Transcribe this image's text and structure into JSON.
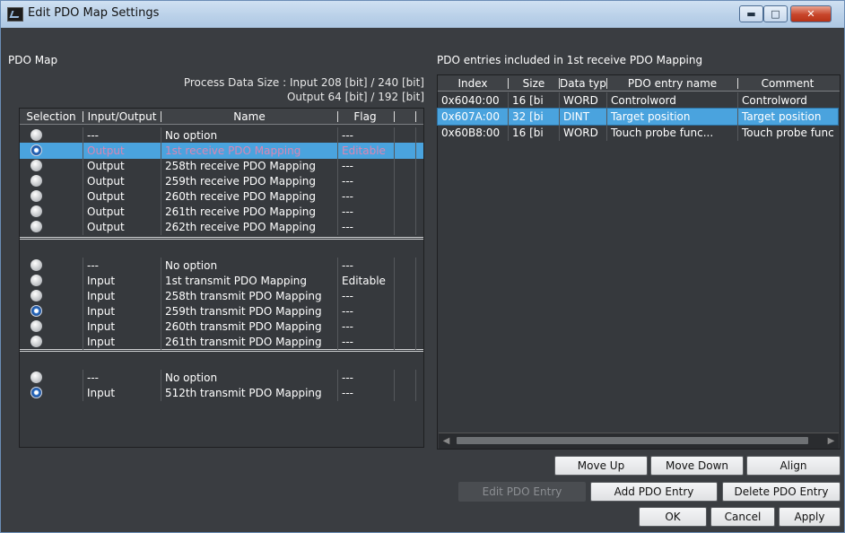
{
  "window": {
    "title": "Edit PDO Map Settings",
    "controls": {
      "minimize": "▬",
      "maximize": "□",
      "close": "✕"
    }
  },
  "pdo_map": {
    "label": "PDO Map",
    "process_size_input": "Process Data Size : Input  208 [bit]  /  240 [bit]",
    "process_size_output": "Output  64 [bit]  /  192 [bit]",
    "columns": [
      "Selection",
      "Input/Output",
      "Name",
      "Flag"
    ],
    "group1": [
      {
        "io": "---",
        "name": "No option",
        "flag": "---",
        "selected": false
      },
      {
        "io": "Output",
        "name": "1st receive PDO Mapping",
        "flag": "Editable",
        "selected": true
      },
      {
        "io": "Output",
        "name": "258th receive PDO Mapping",
        "flag": "---",
        "selected": false
      },
      {
        "io": "Output",
        "name": "259th receive PDO Mapping",
        "flag": "---",
        "selected": false
      },
      {
        "io": "Output",
        "name": "260th receive PDO Mapping",
        "flag": "---",
        "selected": false
      },
      {
        "io": "Output",
        "name": "261th receive PDO Mapping",
        "flag": "---",
        "selected": false
      },
      {
        "io": "Output",
        "name": "262th receive PDO Mapping",
        "flag": "---",
        "selected": false
      }
    ],
    "group2": [
      {
        "io": "---",
        "name": "No option",
        "flag": "---",
        "selected": false
      },
      {
        "io": "Input",
        "name": "1st transmit PDO Mapping",
        "flag": "Editable",
        "selected": false
      },
      {
        "io": "Input",
        "name": "258th transmit PDO Mapping",
        "flag": "---",
        "selected": false
      },
      {
        "io": "Input",
        "name": "259th transmit PDO Mapping",
        "flag": "---",
        "selected": true
      },
      {
        "io": "Input",
        "name": "260th transmit PDO Mapping",
        "flag": "---",
        "selected": false
      },
      {
        "io": "Input",
        "name": "261th transmit PDO Mapping",
        "flag": "---",
        "selected": false
      }
    ],
    "group3": [
      {
        "io": "---",
        "name": "No option",
        "flag": "---",
        "selected": false
      },
      {
        "io": "Input",
        "name": "512th transmit PDO Mapping",
        "flag": "---",
        "selected": true
      }
    ]
  },
  "entries": {
    "label": "PDO entries included in 1st receive PDO Mapping",
    "columns": [
      "Index",
      "Size",
      "Data type",
      "PDO entry name",
      "Comment"
    ],
    "rows": [
      {
        "index": "0x6040:00",
        "size": "16 [bi",
        "type": "WORD",
        "name": "Controlword",
        "comment": "Controlword",
        "selected": false
      },
      {
        "index": "0x607A:00",
        "size": "32 [bi",
        "type": "DINT",
        "name": "Target position",
        "comment": "Target position",
        "selected": true
      },
      {
        "index": "0x60B8:00",
        "size": "16 [bi",
        "type": "WORD",
        "name": "Touch probe func...",
        "comment": "Touch probe func",
        "selected": false
      }
    ]
  },
  "buttons": {
    "move_up": "Move Up",
    "move_down": "Move Down",
    "align": "Align",
    "edit_entry": "Edit PDO Entry",
    "add_entry": "Add PDO Entry",
    "delete_entry": "Delete PDO Entry",
    "ok": "OK",
    "cancel": "Cancel",
    "apply": "Apply"
  }
}
